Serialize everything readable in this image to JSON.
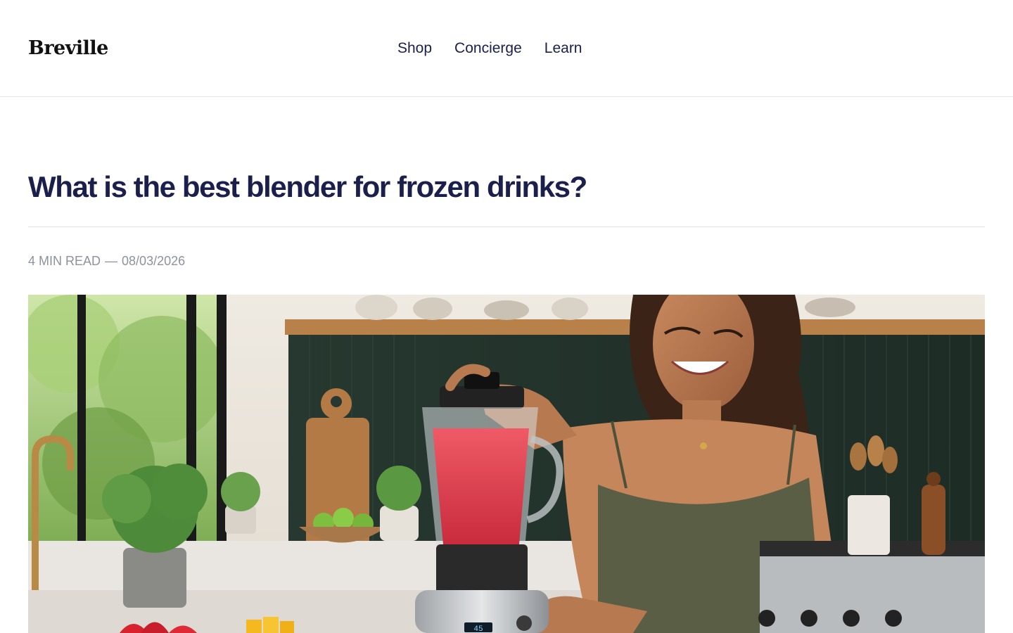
{
  "header": {
    "logo_text": "Breville",
    "nav": [
      {
        "label": "Shop"
      },
      {
        "label": "Concierge"
      },
      {
        "label": "Learn"
      }
    ]
  },
  "article": {
    "title": "What is the best blender for frozen drinks?",
    "read_time": "4 MIN READ",
    "separator": "—",
    "date": "08/03/2026",
    "hero_display": "45"
  },
  "colors": {
    "text_primary": "#1b1f4b",
    "text_muted": "#8f919e",
    "divider": "#e0e0e6"
  }
}
